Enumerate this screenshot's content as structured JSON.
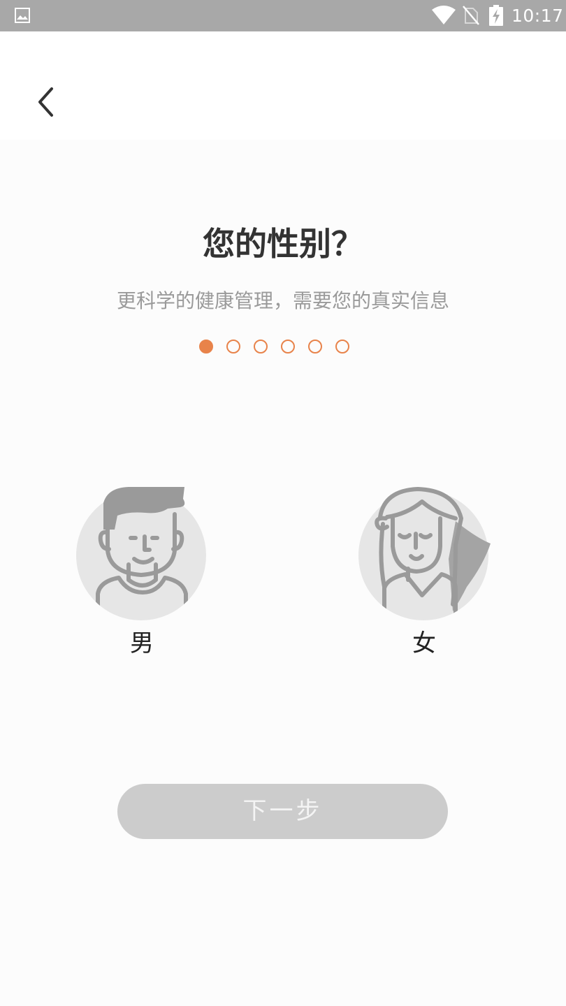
{
  "status_bar": {
    "time": "10:17",
    "icons": [
      "gallery-icon",
      "wifi-icon",
      "no-sim-icon",
      "battery-charging-icon"
    ]
  },
  "header": {
    "back_icon": "chevron-left-icon"
  },
  "main": {
    "title": "您的性别？",
    "subtitle": "更科学的健康管理，需要您的真实信息",
    "steps": {
      "current": 1,
      "total": 6
    }
  },
  "options": {
    "male": {
      "label": "男",
      "icon": "male-avatar-icon"
    },
    "female": {
      "label": "女",
      "icon": "female-avatar-icon"
    }
  },
  "next_button": {
    "label": "下一步"
  },
  "colors": {
    "accent": "#e8834a",
    "status_bar": "#a8a8a8",
    "button_disabled": "#cccccc",
    "avatar_bg": "#e6e6e6",
    "avatar_stroke": "#9a9a9a"
  }
}
